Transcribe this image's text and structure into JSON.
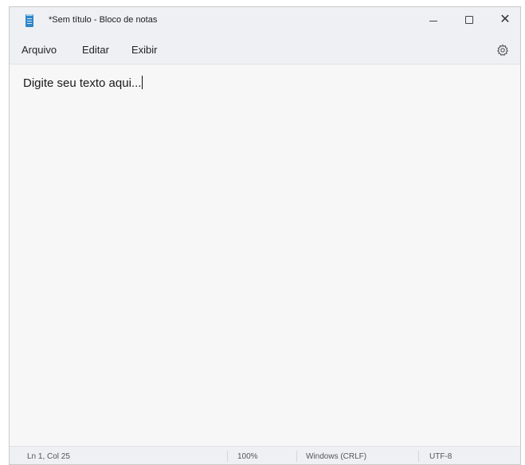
{
  "window": {
    "title": "*Sem título - Bloco de notas",
    "icon": "notepad-icon",
    "controls": {
      "minimize_icon": "minimize-icon",
      "maximize_icon": "maximize-icon",
      "close_icon": "close-icon",
      "close_glyph": "✕"
    }
  },
  "menu": {
    "items": [
      {
        "label": "Arquivo"
      },
      {
        "label": "Editar"
      },
      {
        "label": "Exibir"
      }
    ],
    "settings_icon": "gear-icon"
  },
  "editor": {
    "text": "Digite seu texto aqui..."
  },
  "statusbar": {
    "position": "Ln 1, Col 25",
    "zoom": "100%",
    "line_ending": "Windows (CRLF)",
    "encoding": "UTF-8"
  }
}
